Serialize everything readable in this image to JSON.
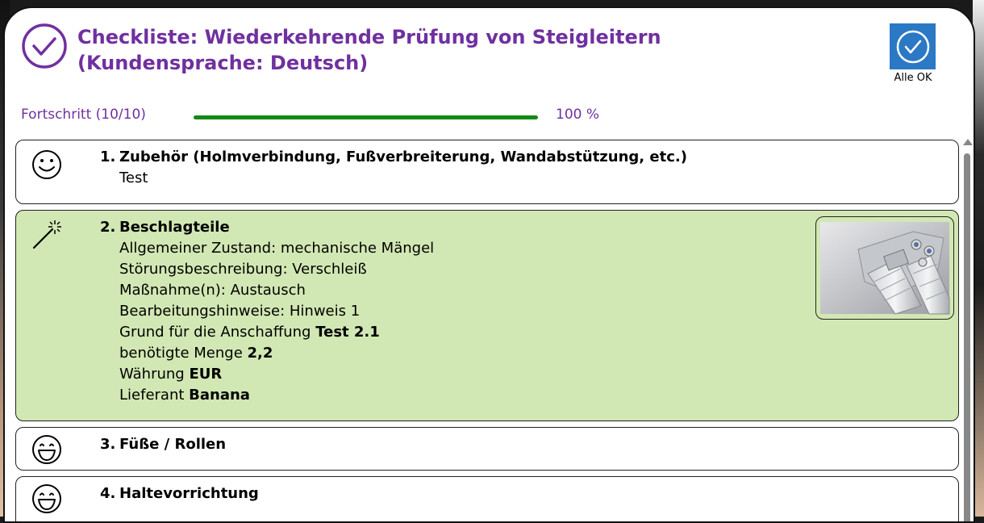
{
  "header": {
    "title_line1": "Checkliste: Wiederkehrende Prüfung von Steigleitern",
    "title_line2": "(Kundensprache: Deutsch)",
    "icon": "check-circle-icon",
    "all_ok_label": "Alle OK",
    "all_ok_icon": "check-circle-icon"
  },
  "progress": {
    "label": "Fortschritt (10/10)",
    "percent_text": "100 %",
    "value": 1.0,
    "color": "#138a14"
  },
  "colors": {
    "accent": "#7030a0",
    "active_item_bg": "#d2e8b4",
    "all_ok_bg": "#2b78c5"
  },
  "items": [
    {
      "num": "1.",
      "title": "Zubehör (Holmverbindung, Fußverbreiterung, Wandabstützung, etc.)",
      "icon": "smiley-icon",
      "line1": "Test"
    },
    {
      "num": "2.",
      "title": "Beschlagteile",
      "icon": "magic-wand-icon",
      "details": [
        "Allgemeiner Zustand: mechanische Mängel",
        "Störungsbeschreibung: Verschleiß",
        "Maßnahme(n): Austausch",
        "Bearbeitungshinweise: Hinweis 1"
      ],
      "grund_label": "Grund für die Anschaffung",
      "grund_value": "Test 2.1",
      "menge_label": "benötigte Menge",
      "menge_value": "2,2",
      "waehrung_label": "Währung",
      "waehrung_value": "EUR",
      "lieferant_label": "Lieferant",
      "lieferant_value": "Banana"
    },
    {
      "num": "3.",
      "title": "Füße / Rollen",
      "icon": "grin-icon"
    },
    {
      "num": "4.",
      "title": "Haltevorrichtung",
      "icon": "grin-icon"
    }
  ]
}
